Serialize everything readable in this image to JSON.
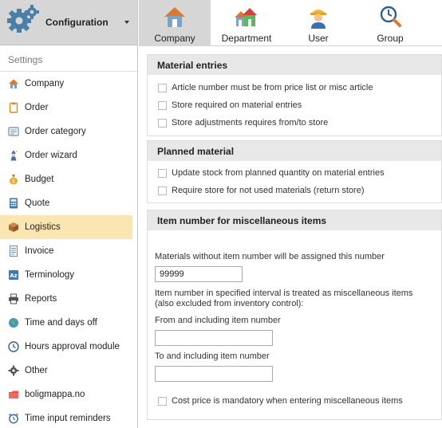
{
  "sidebar": {
    "title": "Configuration",
    "section_heading": "Settings",
    "items": [
      {
        "label": "Company",
        "icon": "house-icon"
      },
      {
        "label": "Order",
        "icon": "clipboard-icon"
      },
      {
        "label": "Order category",
        "icon": "folder-icon"
      },
      {
        "label": "Order wizard",
        "icon": "wizard-icon"
      },
      {
        "label": "Budget",
        "icon": "moneybag-icon"
      },
      {
        "label": "Quote",
        "icon": "calculator-icon"
      },
      {
        "label": "Logistics",
        "icon": "box-icon",
        "active": true
      },
      {
        "label": "Invoice",
        "icon": "invoice-icon"
      },
      {
        "label": "Terminology",
        "icon": "terminology-icon"
      },
      {
        "label": "Reports",
        "icon": "printer-icon"
      },
      {
        "label": "Time and days off",
        "icon": "globe-icon"
      },
      {
        "label": "Hours approval module",
        "icon": "clock-icon"
      },
      {
        "label": "Other",
        "icon": "gear-icon"
      },
      {
        "label": "boligmappa.no",
        "icon": "boligmappa-icon"
      },
      {
        "label": "Time input reminders",
        "icon": "alarm-clock-icon"
      }
    ]
  },
  "tabs": [
    {
      "label": "Company",
      "icon": "house-icon",
      "active": true
    },
    {
      "label": "Department",
      "icon": "houses-icon"
    },
    {
      "label": "User",
      "icon": "worker-icon"
    },
    {
      "label": "Group",
      "icon": "group-icon"
    }
  ],
  "material_entries": {
    "header": "Material entries",
    "options": [
      "Article number must be from price list or misc article",
      "Store required on material entries",
      "Store adjustments requires from/to store"
    ]
  },
  "planned_material": {
    "header": "Planned material",
    "options": [
      "Update stock from planned quantity on material entries",
      "Require store for not used materials (return store)"
    ]
  },
  "misc_items": {
    "header": "Item number for miscellaneous items",
    "assign_label": "Materials without item number will be assigned this number",
    "assign_value": "99999",
    "interval_label": "Item number in specified interval is treated as miscellaneous items (also excluded from inventory control):",
    "from_label": "From and including item number",
    "from_value": "",
    "to_label": "To and including item number",
    "to_value": "",
    "cost_price_option": "Cost price is mandatory when entering miscellaneous items"
  },
  "colors": {
    "active_item_bg": "#fbe6b3",
    "active_tab_bg": "#d6d6d6",
    "group_header_bg": "#e8e8e8"
  }
}
